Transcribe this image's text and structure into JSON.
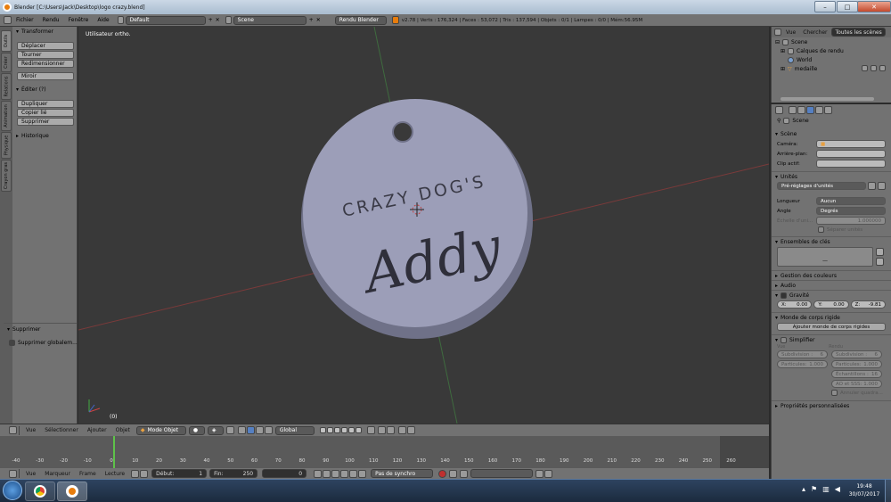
{
  "window": {
    "title": "Blender [C:\\Users\\Jack\\Desktop\\logo crazy.blend]",
    "min": "–",
    "max": "□",
    "close": "✕"
  },
  "topbar": {
    "menus": [
      "Fichier",
      "Rendu",
      "Fenêtre",
      "Aide"
    ],
    "layout": "Default",
    "scene": "Scene",
    "engine": "Rendu Blender",
    "stats": "v2.78 | Verts : 176,324 | Faces : 53,072 | Tris : 137,594 | Objets : 0/1 | Lampes : 0/0 | Mém:56.95M"
  },
  "toolshelf": {
    "tabs": [
      "Outils",
      "Créer",
      "Relations",
      "Animation",
      "Physique",
      "Crayon gras"
    ],
    "transform_title": "Transformer",
    "transform_buttons": [
      "Déplacer",
      "Tourner",
      "Redimensionner"
    ],
    "mirror": "Miroir",
    "edit_title": "Éditer (?)",
    "edit_buttons": [
      "Dupliquer",
      "Copier lié",
      "Supprimer"
    ],
    "history_title": "Historique",
    "operator_title": "Supprimer",
    "operator_option": "Supprimer globalem..."
  },
  "viewport": {
    "label": "Utilisateur ortho.",
    "frame": "(0)",
    "model_top_text": "CRAZY DOG'S",
    "model_script_text": "Addy"
  },
  "vp_header": {
    "menus": [
      "Vue",
      "Sélectionner",
      "Ajouter",
      "Objet"
    ],
    "mode": "Mode Objet",
    "orientation": "Global"
  },
  "timeline": {
    "ticks": [
      "-40",
      "-30",
      "-20",
      "-10",
      "0",
      "10",
      "20",
      "30",
      "40",
      "50",
      "60",
      "70",
      "80",
      "90",
      "100",
      "110",
      "120",
      "130",
      "140",
      "150",
      "160",
      "170",
      "180",
      "190",
      "200",
      "210",
      "220",
      "230",
      "240",
      "250",
      "260"
    ],
    "menus": [
      "Vue",
      "Marqueur",
      "Frame",
      "Lecture"
    ],
    "start_label": "Début:",
    "start": "1",
    "end_label": "Fin:",
    "end": "250",
    "current": "0",
    "sync": "Pas de synchro"
  },
  "outliner": {
    "tabs": [
      "Vue",
      "Chercher",
      "Toutes les scènes"
    ],
    "items": [
      "Scene",
      "Calques de rendu",
      "World",
      "medaille"
    ]
  },
  "props": {
    "context": "Scene",
    "scene_section": "Scène",
    "camera_label": "Caméra:",
    "background_label": "Arrière-plan:",
    "clip_label": "Clip actif:",
    "units_section": "Unités",
    "units_preset": "Pré-réglages d'unités",
    "length_label": "Longueur",
    "length_value": "Aucun",
    "angle_label": "Angle",
    "angle_value": "Degrés",
    "scale_label": "Échelle d'uni...",
    "scale_value": "1.000000",
    "separate_units": "Séparer unités",
    "keying_section": "Ensembles de clés",
    "keying_dash": "—",
    "color_mgmt": "Gestion des couleurs",
    "audio": "Audio",
    "gravity": "Gravité",
    "gx_label": "X:",
    "gx": "0.00",
    "gy_label": "Y:",
    "gy": "0.00",
    "gz_label": "Z:",
    "gz": "-9.81",
    "rigid_section": "Monde de corps rigide",
    "rigid_button": "Ajouter monde de corps rigides",
    "simplify": "Simplifier",
    "view_col": "Vue",
    "render_col": "Rendu",
    "subdiv_label": "Subdivision :",
    "subdiv_view": "6",
    "subdiv_render": "6",
    "particles_label": "Particules:",
    "particles_view": "1.000",
    "particles_render": "1.000",
    "samples_label": "Échantillons :",
    "samples": "16",
    "ao_label": "AO et SSS:",
    "ao": "1.000",
    "cull": "Annuler quadra...",
    "custom_props": "Propriétés personnalisées"
  },
  "taskbar": {
    "time": "19:48",
    "date": "30/07/2017"
  }
}
